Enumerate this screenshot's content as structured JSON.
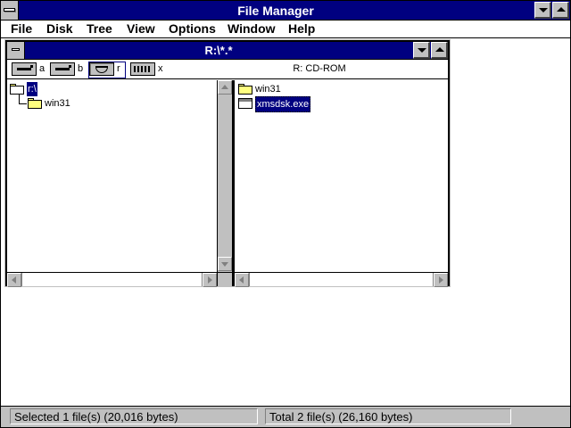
{
  "app": {
    "title": "File Manager"
  },
  "menu": {
    "items": [
      {
        "label": "File"
      },
      {
        "label": "Disk"
      },
      {
        "label": "Tree"
      },
      {
        "label": "View"
      },
      {
        "label": "Options"
      },
      {
        "label": "Window"
      },
      {
        "label": "Help"
      }
    ]
  },
  "child": {
    "title": "R:\\*.*"
  },
  "drives": {
    "items": [
      {
        "letter": "a",
        "icon": "floppy-drive-icon"
      },
      {
        "letter": "b",
        "icon": "floppy-drive-icon"
      },
      {
        "letter": "r",
        "icon": "cd-rom-drive-icon",
        "selected": true
      },
      {
        "letter": "x",
        "icon": "network-drive-icon"
      }
    ],
    "current_label": "R: CD-ROM"
  },
  "tree": {
    "root": "r:\\",
    "children": [
      "win31"
    ]
  },
  "directory": {
    "items": [
      {
        "name": "win31",
        "type": "folder"
      },
      {
        "name": "xmsdsk.exe",
        "type": "file",
        "selected": true
      }
    ]
  },
  "status": {
    "selected": "Selected 1 file(s) (20,016 bytes)",
    "total": "Total 2 file(s) (26,160 bytes)"
  },
  "colors": {
    "title_bar": "#000080",
    "face": "#c0c0c0",
    "folder": "#ffff80"
  }
}
